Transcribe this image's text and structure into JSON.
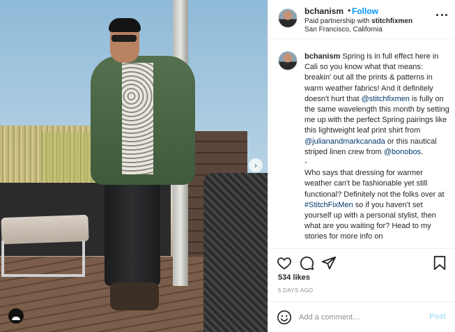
{
  "photo": {
    "carousel_next_glyph": "›",
    "tag_icon": "user-tag-icon"
  },
  "header": {
    "username": "bchanism",
    "dot": "•",
    "follow_label": "Follow",
    "partnership_prefix": "Paid partnership with ",
    "partner": "stitchfixmen",
    "location": "San Francisco, California",
    "more_icon": "more-options-icon"
  },
  "caption": {
    "username": "bchanism",
    "p1_a": " Spring is in full effect here in Cali so you know what that means: breakin' out all the prints & patterns in warm weather fabrics! And it definitely doesn't hurt that ",
    "mention1": "@stitchfixmen",
    "p1_b": " is fully on the same wavelength this month by setting me up with the perfect Spring pairings like this lightweight leaf print shirt from ",
    "mention2": "@julianandmarkcanada",
    "p1_c": " or this nautical striped linen crew from ",
    "mention3": "@bonobos",
    "p1_d": ".",
    "dash": "-",
    "p2_a": "Who says that dressing for warmer weather can't be fashionable yet still functional? Definitely not the folks over at ",
    "hashtag": "#StitchFixMen",
    "p2_b": " so if you haven't set yourself up with a personal stylist, then what are you waiting for? Head to my stories for more info on"
  },
  "actions": {
    "like_icon": "heart-icon",
    "comment_icon": "comment-icon",
    "share_icon": "share-icon",
    "save_icon": "bookmark-icon"
  },
  "likes": "534 likes",
  "date": "5 DAYS AGO",
  "comment_box": {
    "emoji_icon": "smiley-icon",
    "placeholder": "Add a comment…",
    "post_label": "Post"
  },
  "colors": {
    "link": "#0095f6",
    "mention": "#00376b",
    "post_disabled": "#b2dffc",
    "muted": "#8e8e8e"
  }
}
